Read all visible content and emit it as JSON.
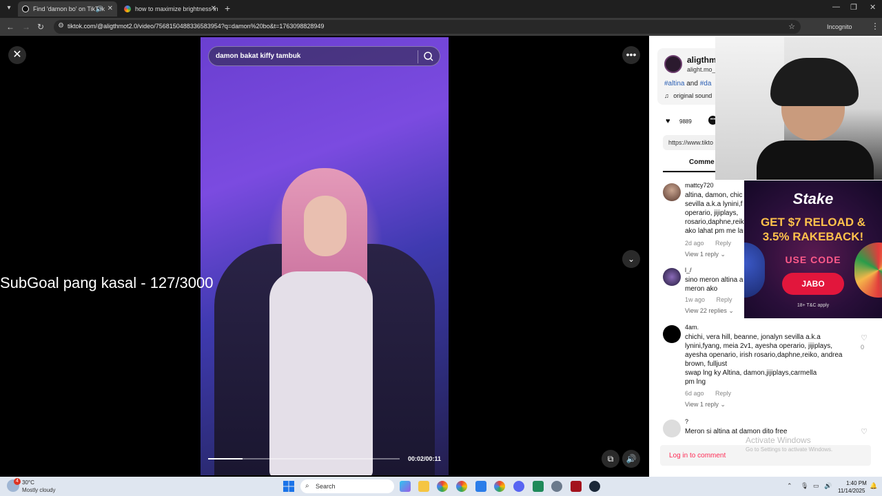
{
  "browser": {
    "tabs": [
      {
        "title": "Find 'damon bo' on TikTok",
        "active": true
      },
      {
        "title": "how to maximize brightness in",
        "active": false
      }
    ],
    "url": "tiktok.com/@aligthmot2.0/video/7568150488336583954?q=damon%20bo&t=1763098828949",
    "incognito_label": "Incognito"
  },
  "video": {
    "search_text": "damon bakat kiffy tambuk",
    "progress_fraction": 0.18,
    "time_text": "00:02/00:11",
    "overlay_text": "SubGoal pang kasal - 127/3000"
  },
  "panel": {
    "author_name": "aligthm",
    "author_handle": "alight.mo_",
    "desc_tag1": "#altina",
    "desc_and": "and",
    "desc_tag2": "#da",
    "sound": "original sound",
    "likes": "9889",
    "link": "https://www.tikto",
    "tab_comments": "Comme",
    "login": "Log in to comment",
    "activate_title": "Activate Windows",
    "activate_sub": "Go to Settings to activate Windows."
  },
  "comments": [
    {
      "user": "mattcy720",
      "lines": [
        "altina, damon, chic",
        "sevilla a.k.a lynini,f",
        "operario, jijiplays,",
        "rosario,daphne,reik",
        "ako lahat pm me la"
      ],
      "date": "2d ago",
      "reply": "Reply",
      "view": "View 1 reply",
      "like_count": ""
    },
    {
      "user": "l_/",
      "lines": [
        "sino meron altina a",
        "meron ako"
      ],
      "date": "1w ago",
      "reply": "Reply",
      "view": "View 22 replies",
      "like_count": ""
    },
    {
      "user": "4am.",
      "lines": [
        "chichi, vera hill, beanne, jonalyn sevilla a.k.a",
        "lynini,fyang, meia 2v1, ayesha operario, jijiplays,",
        "ayesha openario, irish rosario,daphne,reiko, andrea",
        "brown, fulljust",
        "swap lng ky Altina, damon,jijiplays,carmella",
        "pm lng"
      ],
      "date": "6d ago",
      "reply": "Reply",
      "view": "View 1 reply",
      "like_count": "0"
    },
    {
      "user": "?",
      "lines": [
        "Meron si altina at damon dito free"
      ],
      "date": "",
      "reply": "",
      "view": "",
      "like_count": ""
    }
  ],
  "ad": {
    "logo": "Stake",
    "headline_1": "GET $7 RELOAD &",
    "headline_2": "3.5% RAKEBACK!",
    "use_code": "USE CODE",
    "code": "JABO",
    "terms": "18+ T&C apply"
  },
  "taskbar": {
    "temp": "30°C",
    "weather": "Mostly cloudy",
    "weather_badge": "4",
    "search": "Search",
    "time": "1:40 PM",
    "date": "11/14/2025"
  }
}
